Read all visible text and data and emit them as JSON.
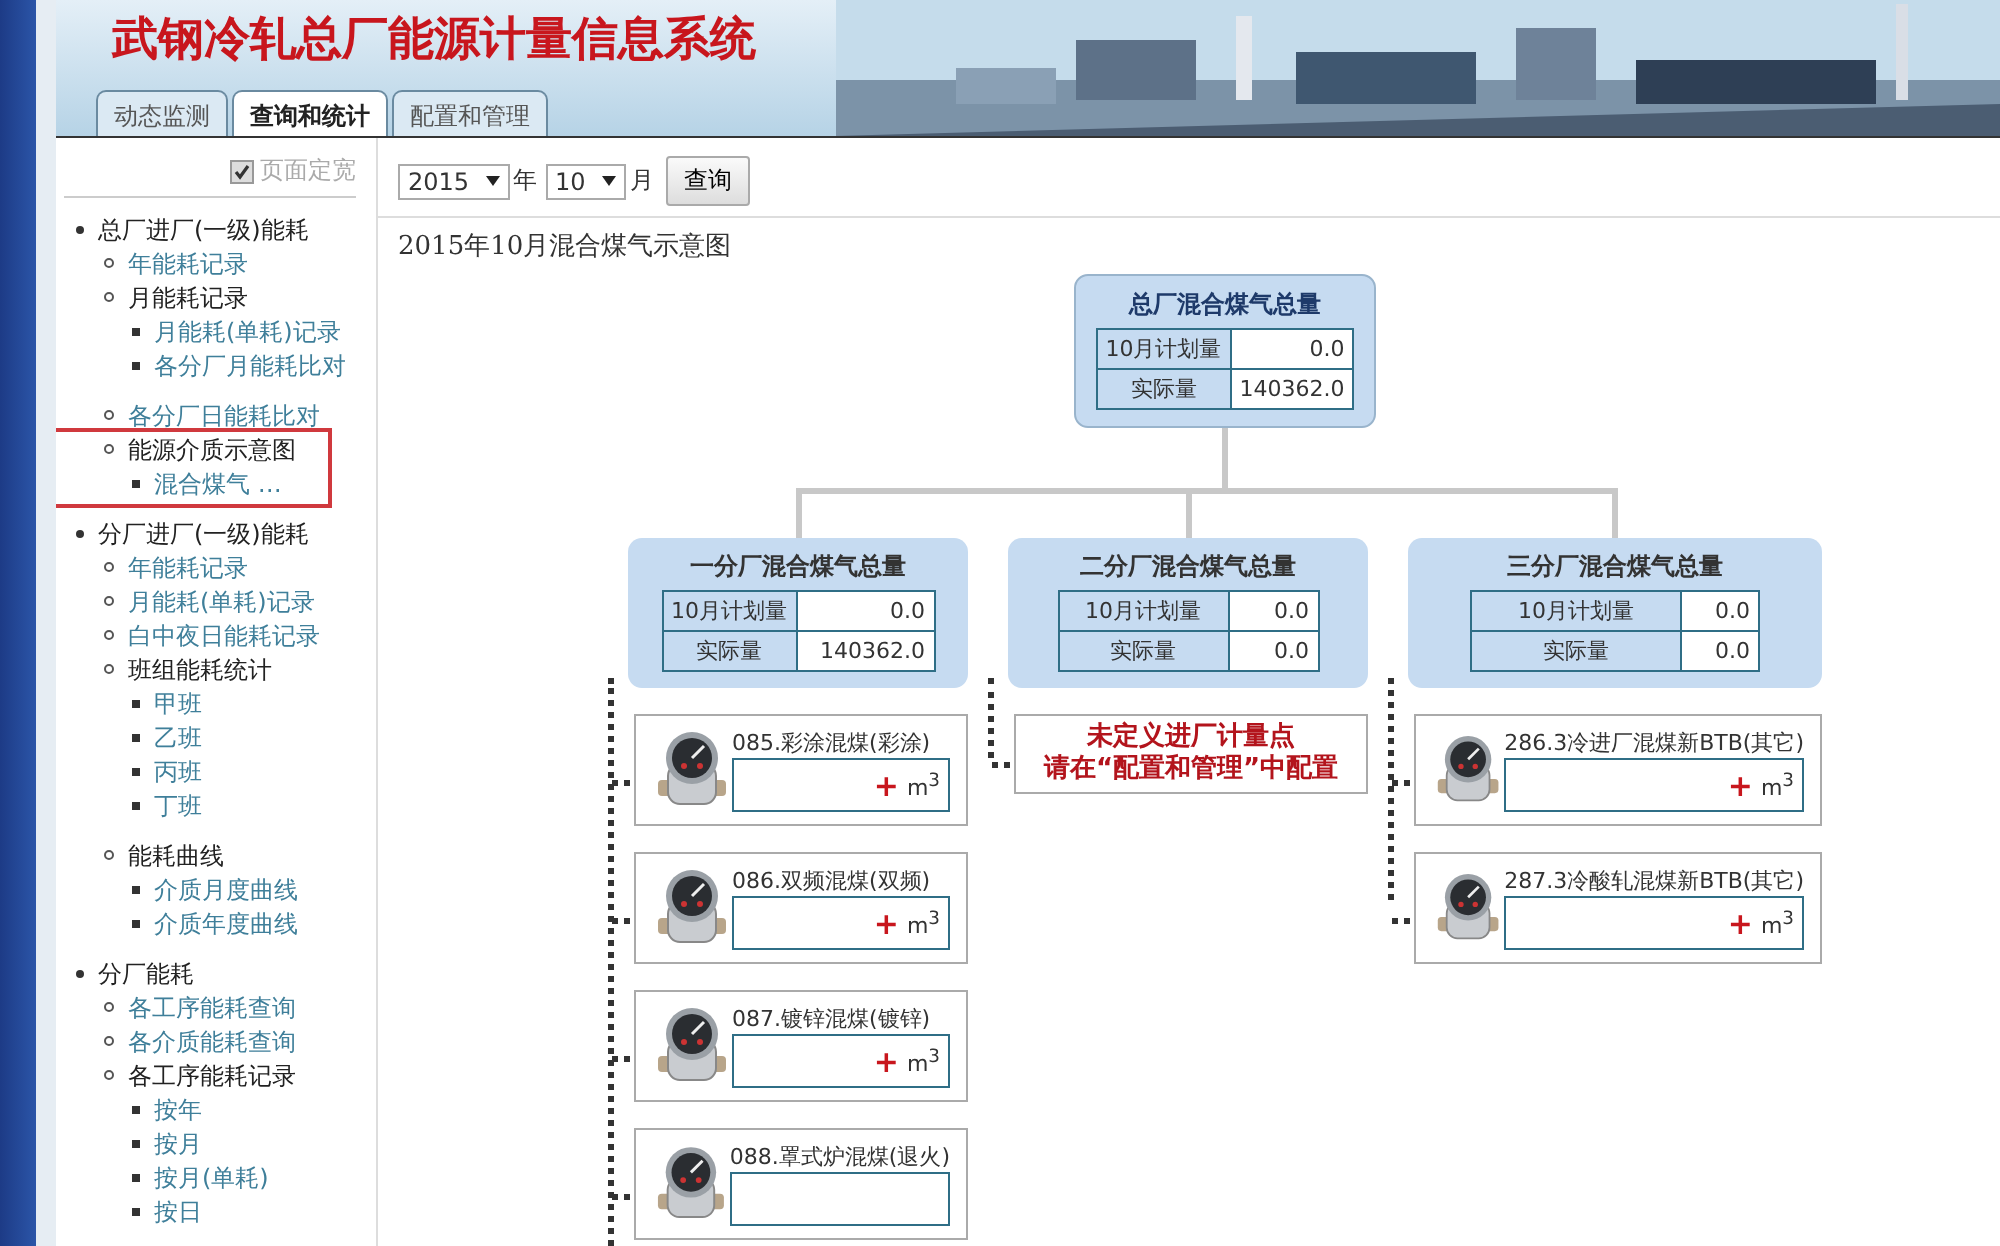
{
  "header": {
    "title": "武钢冷轧总厂能源计量信息系统"
  },
  "tabs": [
    {
      "label": "动态监测",
      "selected": false
    },
    {
      "label": "查询和统计",
      "selected": true
    },
    {
      "label": "配置和管理",
      "selected": false
    }
  ],
  "sidebar": {
    "fixed_width": {
      "label": "页面定宽",
      "checked": true
    },
    "items": [
      {
        "label": "总厂进厂(一级)能耗",
        "children": [
          {
            "label": "年能耗记录"
          },
          {
            "label": "月能耗记录",
            "children": [
              {
                "label": "月能耗(单耗)记录"
              },
              {
                "label": "各分厂月能耗比对"
              }
            ]
          },
          {
            "label": "各分厂日能耗比对"
          },
          {
            "label": "能源介质示意图",
            "highlighted": true,
            "children": [
              {
                "label": "混合煤气 …"
              }
            ]
          }
        ]
      },
      {
        "label": "分厂进厂(一级)能耗",
        "children": [
          {
            "label": "年能耗记录"
          },
          {
            "label": "月能耗(单耗)记录"
          },
          {
            "label": "白中夜日能耗记录"
          },
          {
            "label": "班组能耗统计",
            "children": [
              {
                "label": "甲班"
              },
              {
                "label": "乙班"
              },
              {
                "label": "丙班"
              },
              {
                "label": "丁班"
              }
            ]
          },
          {
            "label": "能耗曲线",
            "children": [
              {
                "label": "介质月度曲线"
              },
              {
                "label": "介质年度曲线"
              }
            ]
          }
        ]
      },
      {
        "label": "分厂能耗",
        "children": [
          {
            "label": "各工序能耗查询"
          },
          {
            "label": "各介质能耗查询"
          },
          {
            "label": "各工序能耗记录",
            "children": [
              {
                "label": "按年"
              },
              {
                "label": "按月"
              },
              {
                "label": "按月(单耗)"
              },
              {
                "label": "按日"
              }
            ]
          }
        ]
      }
    ]
  },
  "query": {
    "year": "2015",
    "year_unit": "年",
    "month": "10",
    "month_unit": "月",
    "button": "查询"
  },
  "caption": "2015年10月混合煤气示意图",
  "root": {
    "title": "总厂混合煤气总量",
    "rows": [
      {
        "label": "10月计划量",
        "value": "0.0"
      },
      {
        "label": "实际量",
        "value": "140362.0"
      }
    ]
  },
  "branches": [
    {
      "title": "一分厂混合煤气总量",
      "rows": [
        {
          "label": "10月计划量",
          "value": "0.0"
        },
        {
          "label": "实际量",
          "value": "140362.0"
        }
      ],
      "points": [
        {
          "kind": "meter",
          "name": "085.彩涂混煤(彩涂)",
          "plus": "+",
          "unit": "m$^{3}$"
        },
        {
          "kind": "meter",
          "name": "086.双频混煤(双频)",
          "plus": "+",
          "unit": "m$^{3}$"
        },
        {
          "kind": "meter",
          "name": "087.镀锌混煤(镀锌)",
          "plus": "+",
          "unit": "m$^{3}$"
        },
        {
          "kind": "meter",
          "name": "088.罩式炉混煤(退火)"
        }
      ]
    },
    {
      "title": "二分厂混合煤气总量",
      "rows": [
        {
          "label": "10月计划量",
          "value": "0.0"
        },
        {
          "label": "实际量",
          "value": "0.0"
        }
      ],
      "points": [
        {
          "kind": "notice",
          "lines": [
            "未定义进厂计量点",
            "请在“配置和管理”中配置"
          ]
        }
      ]
    },
    {
      "title": "三分厂混合煤气总量",
      "rows": [
        {
          "label": "10月计划量",
          "value": "0.0"
        },
        {
          "label": "实际量",
          "value": "0.0"
        }
      ],
      "points": [
        {
          "kind": "meter",
          "name": "286.3冷进厂混煤新BTB(其它)",
          "plus": "+",
          "unit": "m$^{3}$"
        },
        {
          "kind": "meter",
          "name": "287.3冷酸轧混煤新BTB(其它)",
          "plus": "+",
          "unit": "m$^{3}$"
        }
      ]
    }
  ]
}
